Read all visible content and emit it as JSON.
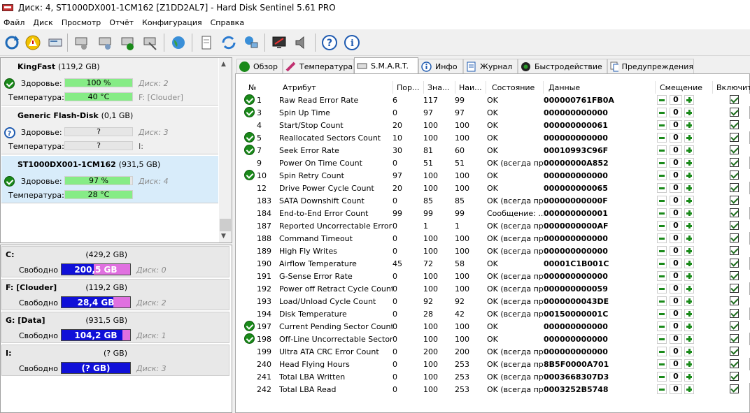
{
  "window": {
    "title": "Диск: 4, ST1000DX001-1CM162 [Z1DD2AL7]  -  Hard Disk Sentinel 5.61 PRO"
  },
  "menu": [
    "Файл",
    "Диск",
    "Просмотр",
    "Отчёт",
    "Конфигурация",
    "Справка"
  ],
  "disks": [
    {
      "name": "KingFast",
      "capacity": "(119,2 GB)",
      "health_label": "Здоровье:",
      "health": "100 %",
      "health_fraction": 1.0,
      "disk_ref": "Диск: 2",
      "temp_label": "Температура:",
      "temp": "40 °C",
      "temp_fraction": 1.0,
      "mount": "F: [Clouder]",
      "status": "ok",
      "selected": false
    },
    {
      "name": "Generic Flash-Disk",
      "capacity": "(0,1 GB)",
      "health_label": "Здоровье:",
      "health": "?",
      "health_fraction": 0,
      "disk_ref": "Диск: 3",
      "temp_label": "Температура:",
      "temp": "?",
      "temp_fraction": 0,
      "mount": "I:",
      "status": "unknown",
      "selected": false
    },
    {
      "name": "ST1000DX001-1CM162",
      "capacity": "(931,5 GB)",
      "health_label": "Здоровье:",
      "health": "97 %",
      "health_fraction": 0.97,
      "disk_ref": "Диск: 4",
      "temp_label": "Температура:",
      "temp": "28 °C",
      "temp_fraction": 1.0,
      "mount": "",
      "status": "ok",
      "selected": true
    }
  ],
  "partitions": [
    {
      "name": "C:",
      "size": "(429,2 GB)",
      "free_label": "Свободно",
      "free": "200,5 GB",
      "free_fraction": 0.47,
      "disk_ref": "Диск: 0"
    },
    {
      "name": "F: [Clouder]",
      "size": "(119,2 GB)",
      "free_label": "Свободно",
      "free": "28,4 GB",
      "free_fraction": 0.76,
      "disk_ref": "Диск: 2"
    },
    {
      "name": "G: [Data]",
      "size": "(931,5 GB)",
      "free_label": "Свободно",
      "free": "104,2 GB",
      "free_fraction": 0.89,
      "disk_ref": "Диск: 1"
    },
    {
      "name": "I:",
      "size": "(? GB)",
      "free_label": "Свободно",
      "free": "(? GB)",
      "free_fraction": 1.0,
      "disk_ref": "Диск: 3"
    }
  ],
  "tabs": [
    {
      "label": "Обзор",
      "icon": "check-circle-icon",
      "active": false
    },
    {
      "label": "Температура",
      "icon": "thermometer-icon",
      "active": false
    },
    {
      "label": "S.M.A.R.T.",
      "icon": "disk-icon",
      "active": true
    },
    {
      "label": "Инфо",
      "icon": "info-icon",
      "active": false
    },
    {
      "label": "Журнал",
      "icon": "log-icon",
      "active": false
    },
    {
      "label": "Быстродействие",
      "icon": "gauge-icon",
      "active": false
    },
    {
      "label": "Предупреждения",
      "icon": "warnings-icon",
      "active": false
    }
  ],
  "table": {
    "headers": [
      "№",
      "Атрибут",
      "Пор...",
      "Зна...",
      "Наи...",
      "Состояние",
      "Данные",
      "Смещение",
      "Включить"
    ],
    "rows": [
      {
        "icon": true,
        "num": "1",
        "attr": "Raw Read Error Rate",
        "thr": "6",
        "val": "117",
        "worst": "99",
        "status": "OK",
        "data": "000000761FB0A",
        "offset": "0"
      },
      {
        "icon": true,
        "num": "3",
        "attr": "Spin Up Time",
        "thr": "0",
        "val": "97",
        "worst": "97",
        "status": "OK",
        "data": "000000000000",
        "offset": "0"
      },
      {
        "icon": false,
        "num": "4",
        "attr": "Start/Stop Count",
        "thr": "20",
        "val": "100",
        "worst": "100",
        "status": "OK",
        "data": "000000000061",
        "offset": "0"
      },
      {
        "icon": true,
        "num": "5",
        "attr": "Reallocated Sectors Count",
        "thr": "10",
        "val": "100",
        "worst": "100",
        "status": "OK",
        "data": "000000000000",
        "offset": "0"
      },
      {
        "icon": true,
        "num": "7",
        "attr": "Seek Error Rate",
        "thr": "30",
        "val": "81",
        "worst": "60",
        "status": "OK",
        "data": "00010993C96F",
        "offset": "0"
      },
      {
        "icon": false,
        "num": "9",
        "attr": "Power On Time Count",
        "thr": "0",
        "val": "51",
        "worst": "51",
        "status": "OK (всегда пр...",
        "data": "00000000A852",
        "offset": "0"
      },
      {
        "icon": true,
        "num": "10",
        "attr": "Spin Retry Count",
        "thr": "97",
        "val": "100",
        "worst": "100",
        "status": "OK",
        "data": "000000000000",
        "offset": "0"
      },
      {
        "icon": false,
        "num": "12",
        "attr": "Drive Power Cycle Count",
        "thr": "20",
        "val": "100",
        "worst": "100",
        "status": "OK",
        "data": "000000000065",
        "offset": "0"
      },
      {
        "icon": false,
        "num": "183",
        "attr": "SATA Downshift Count",
        "thr": "0",
        "val": "85",
        "worst": "85",
        "status": "OK (всегда пр...",
        "data": "00000000000F",
        "offset": "0"
      },
      {
        "icon": false,
        "num": "184",
        "attr": "End-to-End Error Count",
        "thr": "99",
        "val": "99",
        "worst": "99",
        "status": "Сообщение: ...",
        "data": "000000000001",
        "offset": "0"
      },
      {
        "icon": false,
        "num": "187",
        "attr": "Reported Uncorrectable Errors",
        "thr": "0",
        "val": "1",
        "worst": "1",
        "status": "OK (всегда пр...",
        "data": "0000000000AF",
        "offset": "0"
      },
      {
        "icon": false,
        "num": "188",
        "attr": "Command Timeout",
        "thr": "0",
        "val": "100",
        "worst": "100",
        "status": "OK (всегда пр...",
        "data": "000000000000",
        "offset": "0"
      },
      {
        "icon": false,
        "num": "189",
        "attr": "High Fly Writes",
        "thr": "0",
        "val": "100",
        "worst": "100",
        "status": "OK (всегда пр...",
        "data": "000000000000",
        "offset": "0"
      },
      {
        "icon": false,
        "num": "190",
        "attr": "Airflow Temperature",
        "thr": "45",
        "val": "72",
        "worst": "58",
        "status": "OK",
        "data": "00001C1B001C",
        "offset": "0"
      },
      {
        "icon": false,
        "num": "191",
        "attr": "G-Sense Error Rate",
        "thr": "0",
        "val": "100",
        "worst": "100",
        "status": "OK (всегда пр...",
        "data": "000000000000",
        "offset": "0"
      },
      {
        "icon": false,
        "num": "192",
        "attr": "Power off Retract Cycle Count",
        "thr": "0",
        "val": "100",
        "worst": "100",
        "status": "OK (всегда пр...",
        "data": "000000000059",
        "offset": "0"
      },
      {
        "icon": false,
        "num": "193",
        "attr": "Load/Unload Cycle Count",
        "thr": "0",
        "val": "92",
        "worst": "92",
        "status": "OK (всегда пр...",
        "data": "0000000043DE",
        "offset": "0"
      },
      {
        "icon": false,
        "num": "194",
        "attr": "Disk Temperature",
        "thr": "0",
        "val": "28",
        "worst": "42",
        "status": "OK (всегда пр...",
        "data": "00150000001C",
        "offset": "0"
      },
      {
        "icon": true,
        "num": "197",
        "attr": "Current Pending Sector Count",
        "thr": "0",
        "val": "100",
        "worst": "100",
        "status": "OK",
        "data": "000000000000",
        "offset": "0"
      },
      {
        "icon": true,
        "num": "198",
        "attr": "Off-Line Uncorrectable Sector...",
        "thr": "0",
        "val": "100",
        "worst": "100",
        "status": "OK",
        "data": "000000000000",
        "offset": "0"
      },
      {
        "icon": false,
        "num": "199",
        "attr": "Ultra ATA CRC Error Count",
        "thr": "0",
        "val": "200",
        "worst": "200",
        "status": "OK (всегда пр...",
        "data": "000000000000",
        "offset": "0"
      },
      {
        "icon": false,
        "num": "240",
        "attr": "Head Flying Hours",
        "thr": "0",
        "val": "100",
        "worst": "253",
        "status": "OK (всегда пр...",
        "data": "8B5F0000A701",
        "offset": "0"
      },
      {
        "icon": false,
        "num": "241",
        "attr": "Total LBA Written",
        "thr": "0",
        "val": "100",
        "worst": "253",
        "status": "OK (всегда пр...",
        "data": "0003668307D3",
        "offset": "0"
      },
      {
        "icon": false,
        "num": "242",
        "attr": "Total LBA Read",
        "thr": "0",
        "val": "100",
        "worst": "253",
        "status": "OK (всегда пр...",
        "data": "0003252B5748",
        "offset": "0"
      }
    ]
  },
  "colors": {
    "ok_green": "#1a8a1a",
    "health_bar": "#86ec86",
    "free_bar": "#1010d8",
    "used_bar": "#e070e0",
    "selected_row": "#d8ecfa"
  }
}
